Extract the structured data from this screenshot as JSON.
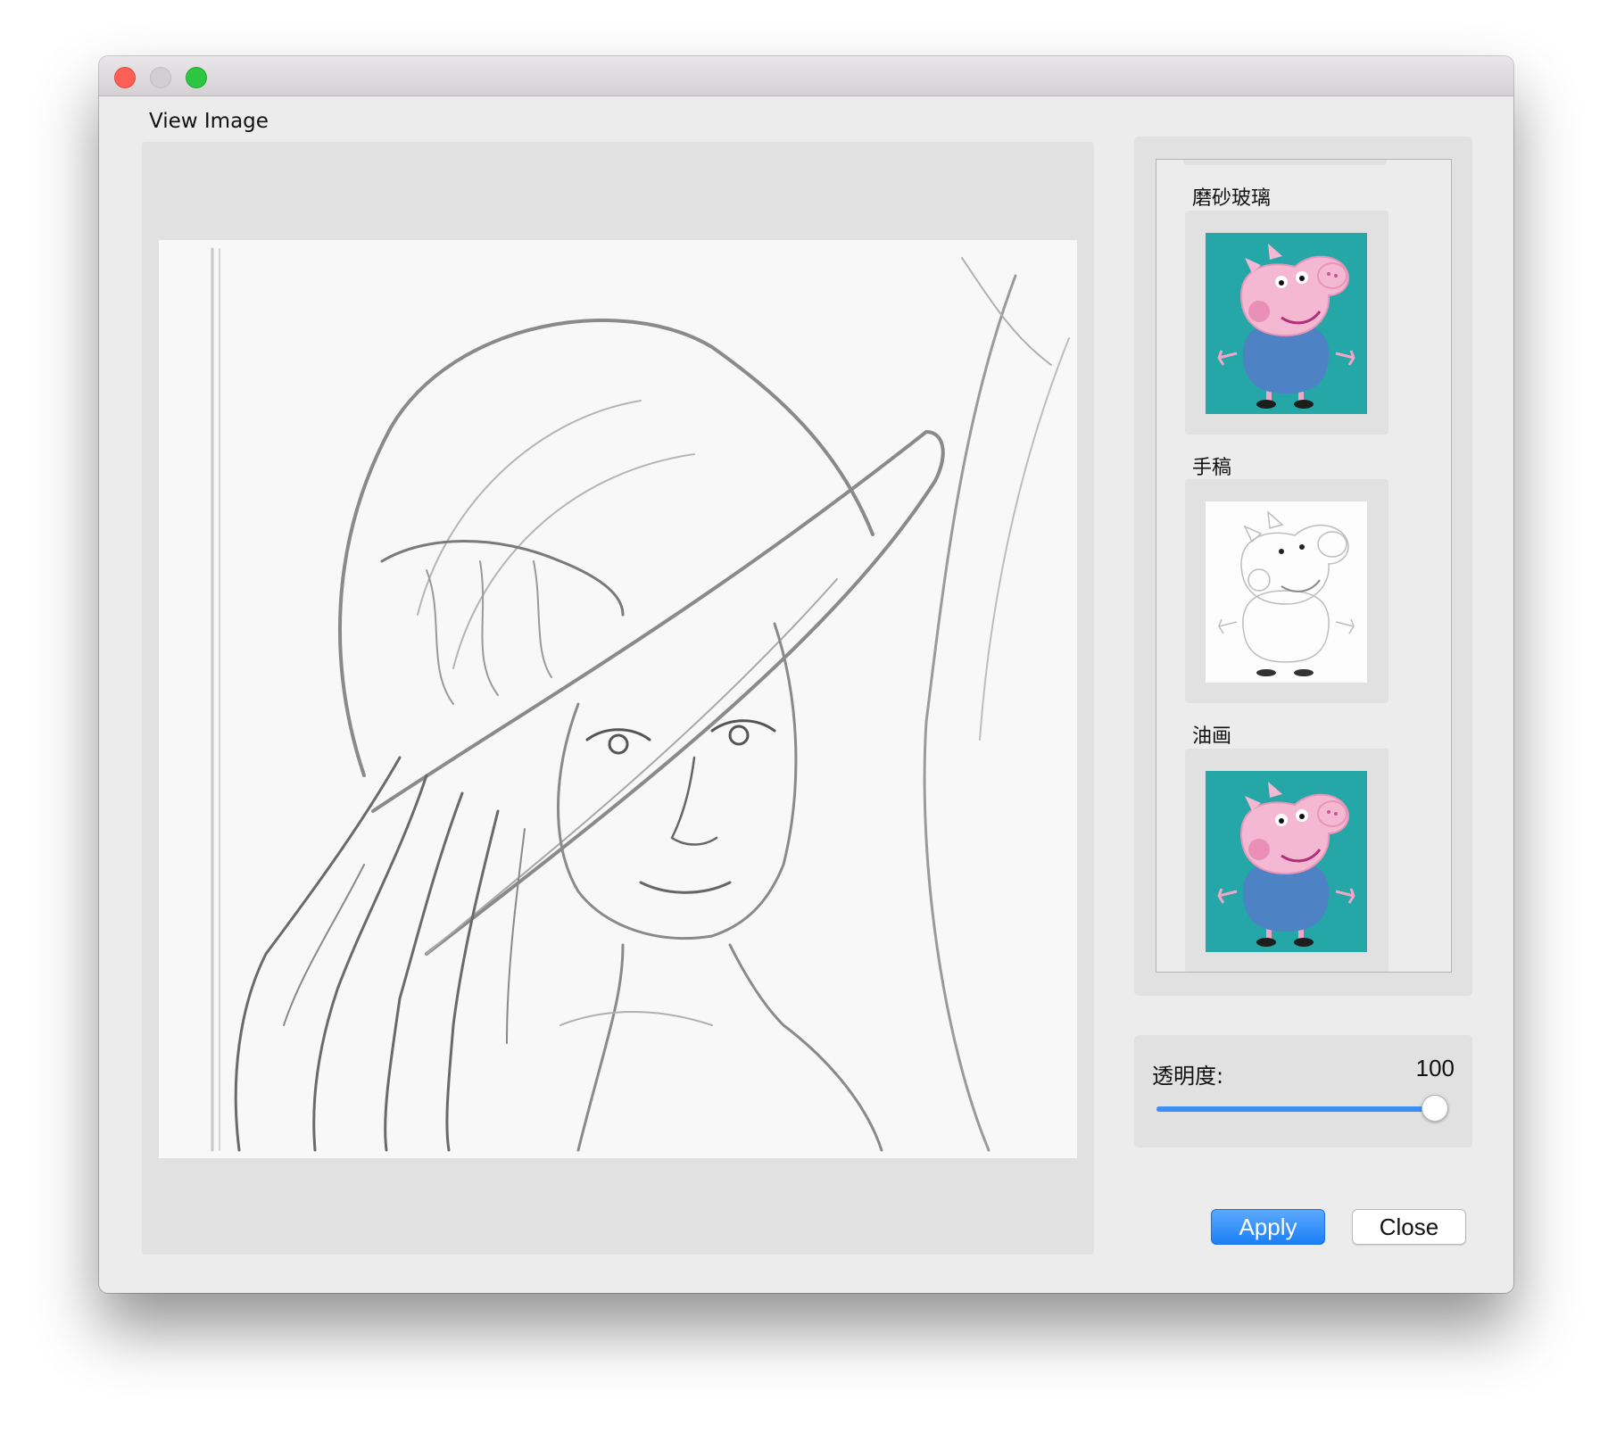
{
  "window": {
    "controls": {
      "close": "close-icon",
      "minimize": "minimize-icon",
      "zoom": "zoom-icon"
    }
  },
  "viewer": {
    "label": "View Image",
    "image": "sketch-portrait-image"
  },
  "effects": [
    {
      "label": "磨砂玻璃",
      "thumbnail": "frosted-glass-pig-thumbnail"
    },
    {
      "label": "手稿",
      "thumbnail": "sketch-pig-thumbnail"
    },
    {
      "label": "油画",
      "thumbnail": "oil-painting-pig-thumbnail"
    }
  ],
  "opacity": {
    "label": "透明度:",
    "value": "100",
    "slider_fraction": 1.0
  },
  "buttons": {
    "apply": "Apply",
    "close": "Close"
  },
  "colors": {
    "accent": "#3d8ff3",
    "thumbnail_background": "#25a7a8",
    "pig_pink": "#f5b8d2",
    "pig_shirt": "#4d82c5"
  }
}
